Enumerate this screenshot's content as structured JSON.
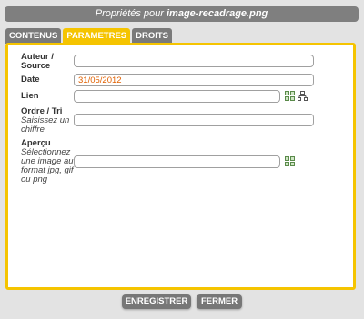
{
  "dialog": {
    "title_prefix": "Propriétés pour ",
    "title_file": "image-recadrage.png"
  },
  "tabs": [
    {
      "label": "CONTENUS",
      "active": false
    },
    {
      "label": "PARAMETRES",
      "active": true
    },
    {
      "label": "DROITS",
      "active": false
    }
  ],
  "form": {
    "author": {
      "label": "Auteur /",
      "label2": "Source",
      "value": ""
    },
    "date": {
      "label": "Date",
      "value": "31/05/2012"
    },
    "link": {
      "label": "Lien",
      "value": ""
    },
    "order": {
      "label": "Ordre / Tri",
      "hint": "Saisissez un chiffre",
      "value": ""
    },
    "preview": {
      "label": "Aperçu",
      "hint": "Sélectionnez une image au format jpg, gif ou png",
      "value": ""
    }
  },
  "buttons": {
    "save": "ENREGISTRER",
    "close": "FERMER"
  },
  "colors": {
    "accent": "#f5c400",
    "tab_inactive": "#7a7a7a",
    "title_bar": "#7f7f7f",
    "date_text": "#e06000"
  }
}
